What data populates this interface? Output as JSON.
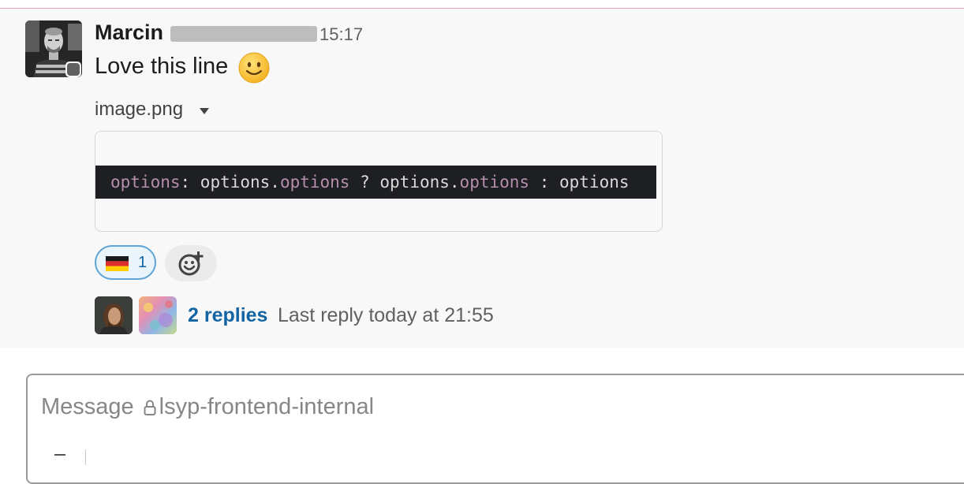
{
  "message": {
    "author": "Marcin",
    "time": "15:17",
    "text": "Love this line",
    "emoji": "smiley-face"
  },
  "attachment": {
    "filename": "image.png",
    "code": {
      "tokens": [
        {
          "text": "options",
          "kw": true
        },
        {
          "text": ": options.",
          "kw": false
        },
        {
          "text": "options",
          "kw": true
        },
        {
          "text": " ? options.",
          "kw": false
        },
        {
          "text": "options",
          "kw": true
        },
        {
          "text": " : options",
          "kw": false
        }
      ]
    }
  },
  "reactions": [
    {
      "emoji": "germany-flag",
      "count": "1"
    }
  ],
  "thread": {
    "replies_label": "2 replies",
    "last_reply": "Last reply today at 21:55"
  },
  "composer": {
    "placeholder_prefix": "Message",
    "channel": "lsyp-frontend-internal"
  },
  "colors": {
    "link": "#1264a3",
    "reaction_border": "#5fa4d4",
    "code_keyword": "#b48ead",
    "code_bg": "#1e1f22"
  }
}
